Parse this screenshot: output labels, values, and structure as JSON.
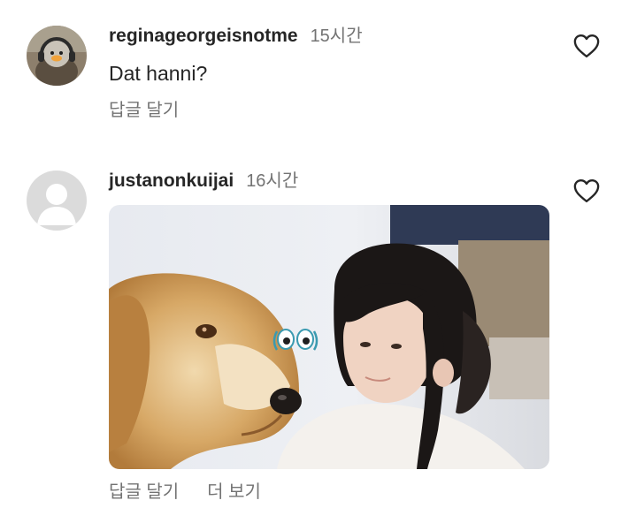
{
  "comments": [
    {
      "username": "reginageorgeisnotme",
      "time": "15시간",
      "text": "Dat hanni?",
      "reply_label": "답글 달기",
      "avatar_icon": "duck-headphones-avatar"
    },
    {
      "username": "justanonkuijai",
      "time": "16시간",
      "reply_label": "답글 달기",
      "more_label": "더 보기",
      "avatar_icon": "default-user-avatar",
      "media": "golden-retriever-and-girl-gif"
    }
  ],
  "icons": {
    "like": "heart-outline-icon"
  }
}
